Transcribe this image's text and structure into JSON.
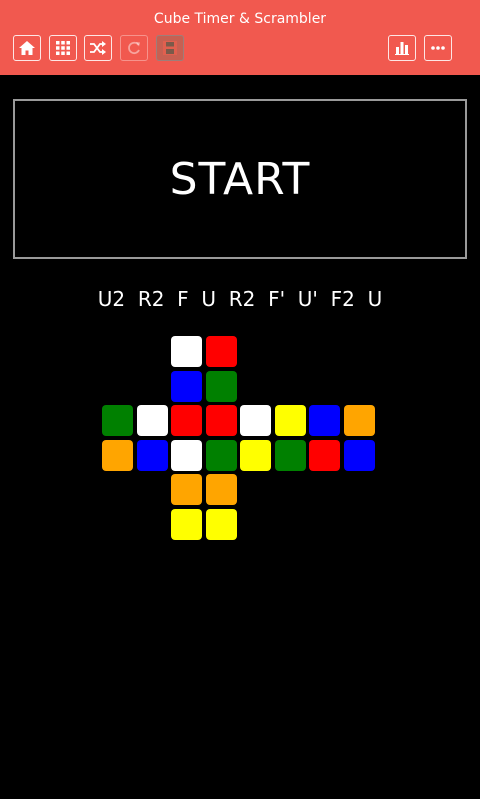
{
  "header": {
    "title": "Cube Timer & Scrambler",
    "accent_color": "#f1594f",
    "left_buttons": [
      {
        "icon": "home-icon"
      },
      {
        "icon": "grid-icon"
      },
      {
        "icon": "shuffle-icon"
      },
      {
        "icon": "refresh-icon",
        "state": "disabled"
      },
      {
        "icon": "save-icon",
        "state": "disabled"
      }
    ],
    "right_buttons": [
      {
        "icon": "bar-chart-icon"
      },
      {
        "icon": "more-icon"
      }
    ]
  },
  "timer": {
    "start_label": "START"
  },
  "scramble": {
    "text": "U2  R2  F  U  R2  F'  U'  F2  U"
  },
  "palette": {
    "W": "#ffffff",
    "R": "#ff0000",
    "B": "#0000ff",
    "G": "#008000",
    "Y": "#ffff00",
    "O": "#ffa500"
  },
  "cube_net": {
    "top": [
      "W",
      "R",
      "B",
      "G"
    ],
    "middle_row_1": [
      "G",
      "W",
      "R",
      "R",
      "W",
      "Y",
      "B",
      "O"
    ],
    "middle_row_2": [
      "O",
      "B",
      "W",
      "G",
      "Y",
      "G",
      "R",
      "B"
    ],
    "bottom": [
      "O",
      "O",
      "Y",
      "Y"
    ]
  }
}
